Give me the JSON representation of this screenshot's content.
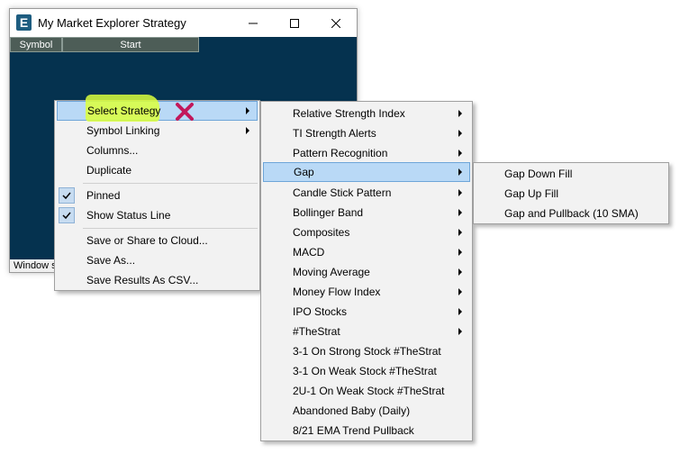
{
  "window": {
    "app_icon_letter": "E",
    "title": "My Market Explorer Strategy",
    "columns": [
      "Symbol",
      "Start"
    ],
    "status_text": "Window s"
  },
  "context_menu": {
    "items": [
      {
        "label": "Select Strategy",
        "submenu": true,
        "highlighted": true,
        "icon": "red-x-annotation"
      },
      {
        "label": "Symbol Linking",
        "submenu": true
      },
      {
        "label": "Columns..."
      },
      {
        "label": "Duplicate"
      },
      {
        "label": "Pinned",
        "checked": true
      },
      {
        "label": "Show Status Line",
        "checked": true
      },
      {
        "label": "Save or Share to Cloud..."
      },
      {
        "label": "Save As..."
      },
      {
        "label": "Save Results As CSV..."
      }
    ]
  },
  "strategy_menu": {
    "items": [
      {
        "label": "Relative Strength Index",
        "submenu": true
      },
      {
        "label": "TI Strength Alerts",
        "submenu": true
      },
      {
        "label": "Pattern Recognition",
        "submenu": true
      },
      {
        "label": "Gap",
        "submenu": true,
        "highlighted": true
      },
      {
        "label": "Candle Stick Pattern",
        "submenu": true
      },
      {
        "label": "Bollinger Band",
        "submenu": true
      },
      {
        "label": "Composites",
        "submenu": true
      },
      {
        "label": "MACD",
        "submenu": true
      },
      {
        "label": "Moving Average",
        "submenu": true
      },
      {
        "label": "Money Flow Index",
        "submenu": true
      },
      {
        "label": "IPO Stocks",
        "submenu": true
      },
      {
        "label": "#TheStrat",
        "submenu": true
      },
      {
        "label": "3-1 On Strong Stock #TheStrat"
      },
      {
        "label": "3-1 On Weak Stock #TheStrat"
      },
      {
        "label": "2U-1 On Weak Stock #TheStrat"
      },
      {
        "label": "Abandoned Baby (Daily)"
      },
      {
        "label": "8/21 EMA Trend Pullback"
      }
    ]
  },
  "gap_menu": {
    "items": [
      {
        "label": "Gap Down Fill"
      },
      {
        "label": "Gap Up Fill"
      },
      {
        "label": "Gap and Pullback (10 SMA)"
      }
    ]
  },
  "colors": {
    "window_bg": "#05324f",
    "highlight": "#b9d9f6",
    "annotation_yellow": "#dcff3c",
    "annotation_red": "#c2185b"
  }
}
